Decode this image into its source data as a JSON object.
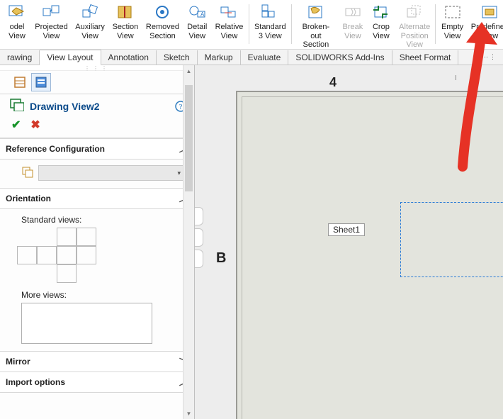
{
  "ribbon": {
    "items": [
      {
        "line1": "odel",
        "line2": "View",
        "sep_after": false,
        "disabled": false,
        "name": "model-view"
      },
      {
        "line1": "Projected",
        "line2": "View",
        "sep_after": false,
        "disabled": false,
        "name": "projected-view"
      },
      {
        "line1": "Auxiliary",
        "line2": "View",
        "sep_after": false,
        "disabled": false,
        "name": "auxiliary-view"
      },
      {
        "line1": "Section",
        "line2": "View",
        "sep_after": false,
        "disabled": false,
        "name": "section-view"
      },
      {
        "line1": "Removed",
        "line2": "Section",
        "sep_after": false,
        "disabled": false,
        "name": "removed-section"
      },
      {
        "line1": "Detail",
        "line2": "View",
        "sep_after": false,
        "disabled": false,
        "name": "detail-view"
      },
      {
        "line1": "Relative",
        "line2": "View",
        "sep_after": true,
        "disabled": false,
        "name": "relative-view"
      },
      {
        "line1": "Standard",
        "line2": "3 View",
        "sep_after": true,
        "disabled": false,
        "name": "standard-3-view"
      },
      {
        "line1": "Broken-out",
        "line2": "Section",
        "sep_after": false,
        "disabled": false,
        "name": "broken-out-section"
      },
      {
        "line1": "Break",
        "line2": "View",
        "sep_after": false,
        "disabled": true,
        "name": "break-view"
      },
      {
        "line1": "Crop",
        "line2": "View",
        "sep_after": false,
        "disabled": false,
        "name": "crop-view"
      },
      {
        "line1": "Alternate",
        "line2": "Position",
        "line3": "View",
        "sep_after": true,
        "disabled": true,
        "name": "alternate-position-view"
      },
      {
        "line1": "Empty",
        "line2": "View",
        "sep_after": false,
        "disabled": false,
        "name": "empty-view"
      },
      {
        "line1": "Predefined",
        "line2": "View",
        "sep_after": false,
        "disabled": false,
        "name": "predefined-view"
      }
    ]
  },
  "cm_tabs": {
    "items": [
      {
        "label": "rawing",
        "name": "tab-drawing"
      },
      {
        "label": "View Layout",
        "name": "tab-view-layout",
        "active": true
      },
      {
        "label": "Annotation",
        "name": "tab-annotation"
      },
      {
        "label": "Sketch",
        "name": "tab-sketch"
      },
      {
        "label": "Markup",
        "name": "tab-markup"
      },
      {
        "label": "Evaluate",
        "name": "tab-evaluate"
      },
      {
        "label": "SOLIDWORKS Add-Ins",
        "name": "tab-addins"
      },
      {
        "label": "Sheet Format",
        "name": "tab-sheet-format"
      }
    ]
  },
  "pm": {
    "title": "Drawing View2",
    "sections": {
      "ref_cfg": {
        "label": "Reference Configuration",
        "expanded": true
      },
      "orient": {
        "label": "Orientation",
        "expanded": true,
        "std_label": "Standard views:",
        "more_label": "More views:"
      },
      "mirror": {
        "label": "Mirror",
        "expanded": false
      },
      "import": {
        "label": "Import options",
        "expanded": true
      }
    },
    "ok_icon": "✔",
    "cancel_icon": "✖"
  },
  "canvas": {
    "ruler_top_label": "4",
    "ruler_left_label": "B",
    "tooltip": "Sheet1"
  },
  "colors": {
    "arrow": "#e63225",
    "blue": "#0a4a8a",
    "dash": "#2a7bd6"
  }
}
